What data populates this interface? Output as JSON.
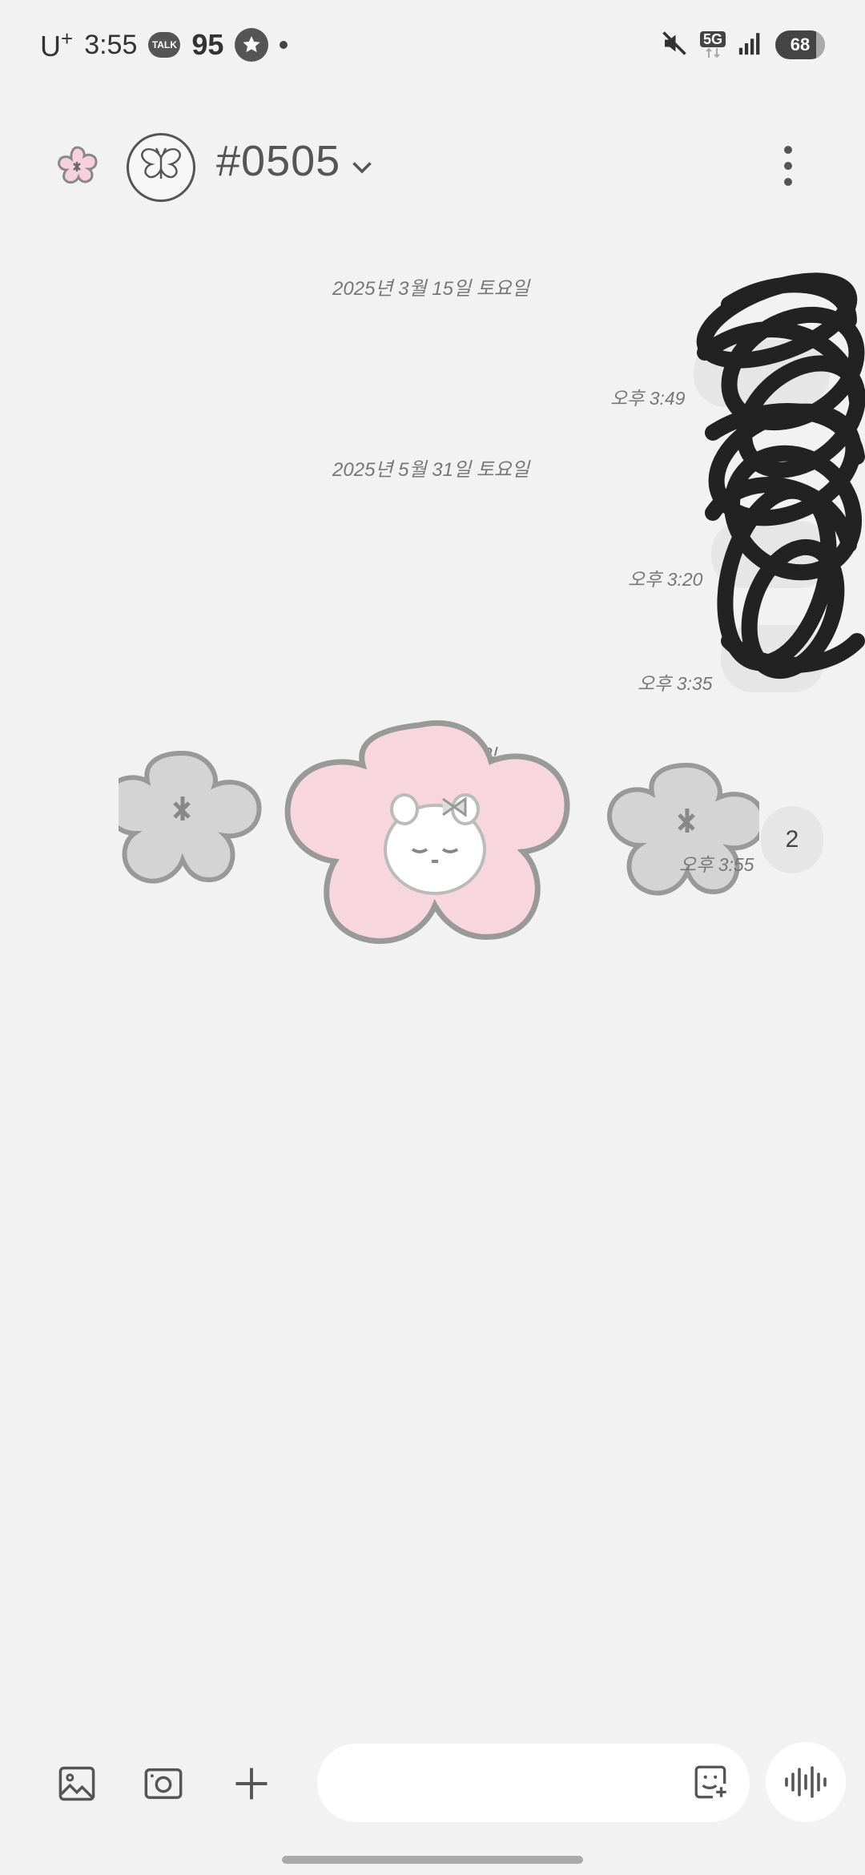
{
  "status_bar": {
    "carrier": "U",
    "carrier_sup": "+",
    "time": "3:55",
    "talk_badge": "TALK",
    "notification_count": "95",
    "network": "5G",
    "battery": "68"
  },
  "header": {
    "title": "#0505"
  },
  "chat": {
    "date_1": "2025년 3월 15일 토요일",
    "time_1": "오후 3:49",
    "date_2": "2025년 5월 31일 토요일",
    "time_2": "오후 3:20",
    "time_3": "오후 3:35",
    "date_3": "5월 30일 토요일",
    "time_4": "오후 3:55",
    "unread_bubble": "2"
  },
  "icons": {
    "back": "flower-icon",
    "profile": "butterfly-icon",
    "dropdown": "chevron-down-icon",
    "menu": "more-vertical-icon",
    "gallery": "image-icon",
    "camera": "camera-icon",
    "add": "plus-icon",
    "emoticon": "emoticon-icon",
    "voice": "voice-wave-icon"
  }
}
